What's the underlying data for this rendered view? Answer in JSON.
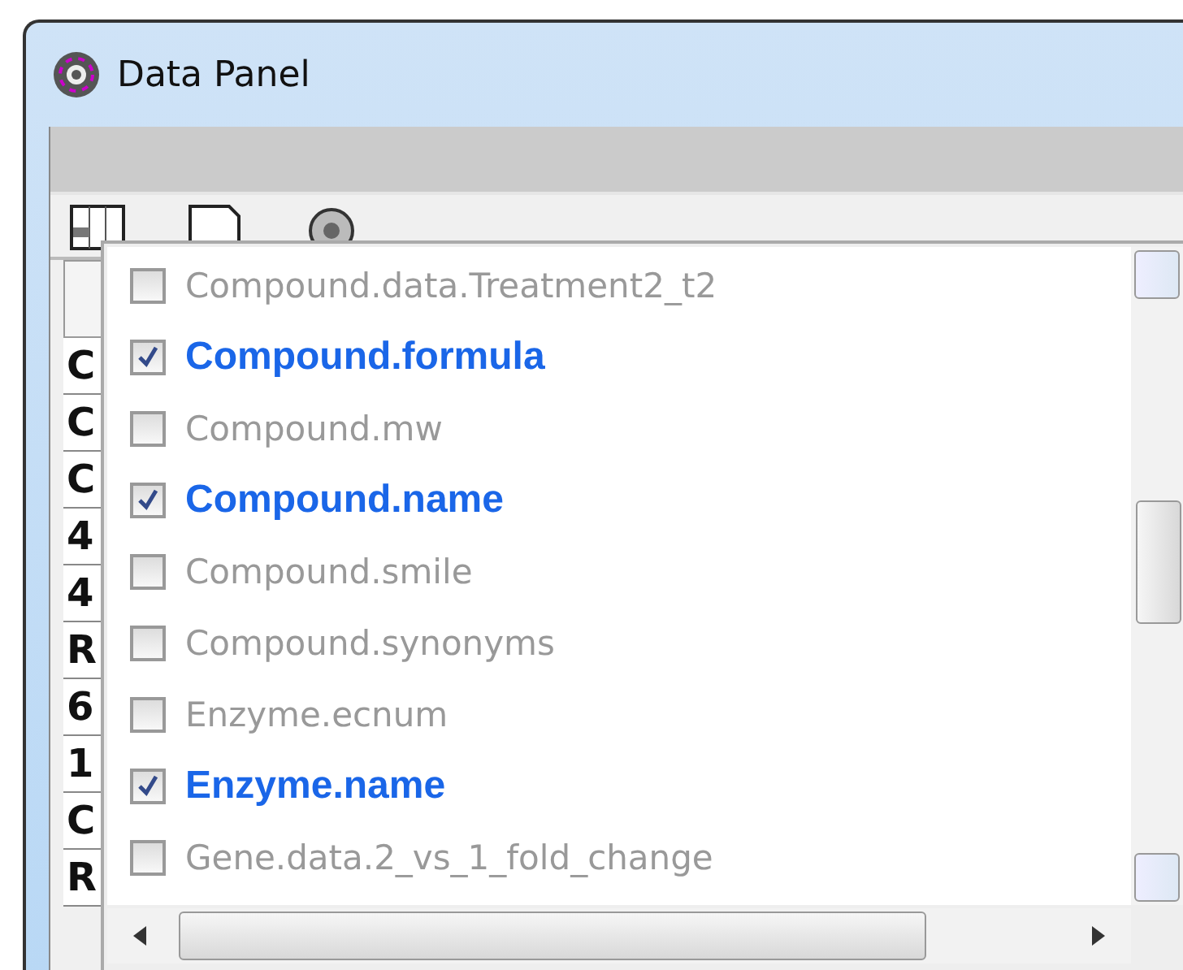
{
  "window": {
    "title": "Data Panel"
  },
  "table": {
    "column_1": [
      "C",
      "C",
      "C",
      "4",
      "4",
      "R",
      "6",
      "1",
      "C",
      "R"
    ]
  },
  "column_list": [
    {
      "label": "Compound.data.Treatment2_t2",
      "checked": false
    },
    {
      "label": "Compound.formula",
      "checked": true
    },
    {
      "label": "Compound.mw",
      "checked": false
    },
    {
      "label": "Compound.name",
      "checked": true
    },
    {
      "label": "Compound.smile",
      "checked": false
    },
    {
      "label": "Compound.synonyms",
      "checked": false
    },
    {
      "label": "Enzyme.ecnum",
      "checked": false
    },
    {
      "label": "Enzyme.name",
      "checked": true
    },
    {
      "label": "Gene.data.2_vs_1_fold_change",
      "checked": false
    }
  ]
}
